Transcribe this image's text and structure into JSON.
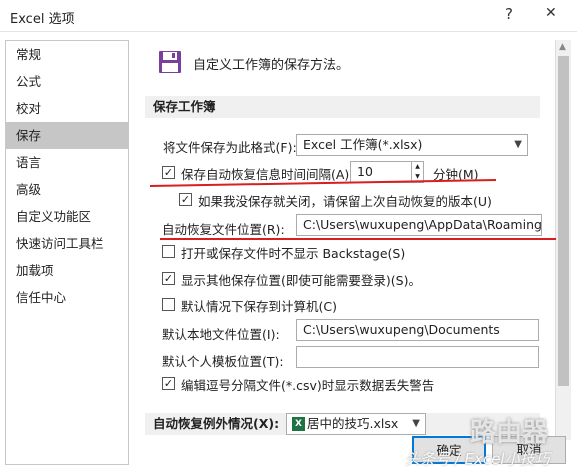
{
  "window": {
    "title": "Excel 选项",
    "help_glyph": "?",
    "close_glyph": "✕"
  },
  "sidebar": {
    "items": [
      {
        "label": "常规",
        "active": false
      },
      {
        "label": "公式",
        "active": false
      },
      {
        "label": "校对",
        "active": false
      },
      {
        "label": "保存",
        "active": true
      },
      {
        "label": "语言",
        "active": false
      },
      {
        "label": "高级",
        "active": false
      },
      {
        "label": "自定义功能区",
        "active": false
      },
      {
        "label": "快速访问工具栏",
        "active": false
      },
      {
        "label": "加载项",
        "active": false
      },
      {
        "label": "信任中心",
        "active": false
      }
    ]
  },
  "main": {
    "header": "自定义工作簿的保存方法。",
    "save_section": {
      "title": "保存工作簿",
      "format_label": "将文件保存为此格式(F):",
      "format_value": "Excel 工作簿(*.xlsx)",
      "autorecover_label": "保存自动恢复信息时间间隔(A)",
      "autorecover_checked": true,
      "autorecover_minutes": "10",
      "minutes_label": "分钟(M)",
      "keep_last_label": "如果我没保存就关闭，请保留上次自动恢复的版本(U)",
      "keep_last_checked": true,
      "autorecover_location_label": "自动恢复文件位置(R):",
      "autorecover_location_value": "C:\\Users\\wuxupeng\\AppData\\Roaming\\M",
      "no_backstage_label": "打开或保存文件时不显示 Backstage(S)",
      "no_backstage_checked": false,
      "show_more_label": "显示其他保存位置(即使可能需要登录)(S)。",
      "show_more_checked": true,
      "default_computer_label": "默认情况下保存到计算机(C)",
      "default_computer_checked": false,
      "default_local_label": "默认本地文件位置(I):",
      "default_local_value": "C:\\Users\\wuxupeng\\Documents",
      "template_label": "默认个人模板位置(T):",
      "template_value": "",
      "csv_warn_label": "编辑逗号分隔文件(*.csv)时显示数据丢失警告",
      "csv_warn_checked": true
    },
    "exceptions_section": {
      "title": "自动恢复例外情况(X):",
      "file_value": "居中的技巧.xlsx"
    }
  },
  "buttons": {
    "ok_label": "确定",
    "cancel_label": "取消"
  },
  "watermark": {
    "text": "头条号 / Excel小技巧",
    "logo_text": "路由器"
  },
  "annotations": {
    "underline_color": "#d81e1e"
  },
  "colors": {
    "active_item_bg": "#c6c6c6",
    "section_bg": "#f0f0f0",
    "ok_border": "#0078d7",
    "excel_green": "#1f7244"
  }
}
